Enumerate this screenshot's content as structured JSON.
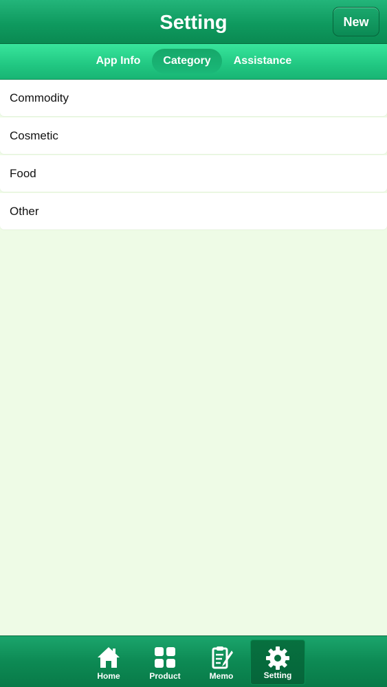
{
  "header": {
    "title": "Setting",
    "new_label": "New"
  },
  "tabs": [
    {
      "label": "App Info",
      "active": false
    },
    {
      "label": "Category",
      "active": true
    },
    {
      "label": "Assistance",
      "active": false
    }
  ],
  "categories": [
    {
      "label": "Commodity"
    },
    {
      "label": "Cosmetic"
    },
    {
      "label": "Food"
    },
    {
      "label": "Other"
    }
  ],
  "bottom_nav": [
    {
      "label": "Home",
      "icon": "home-icon",
      "active": false
    },
    {
      "label": "Product",
      "icon": "grid-icon",
      "active": false
    },
    {
      "label": "Memo",
      "icon": "memo-icon",
      "active": false
    },
    {
      "label": "Setting",
      "icon": "gear-icon",
      "active": true
    }
  ],
  "colors": {
    "header_green": "#0f9a5f",
    "tab_green": "#21c782",
    "background": "#eefbe6"
  }
}
